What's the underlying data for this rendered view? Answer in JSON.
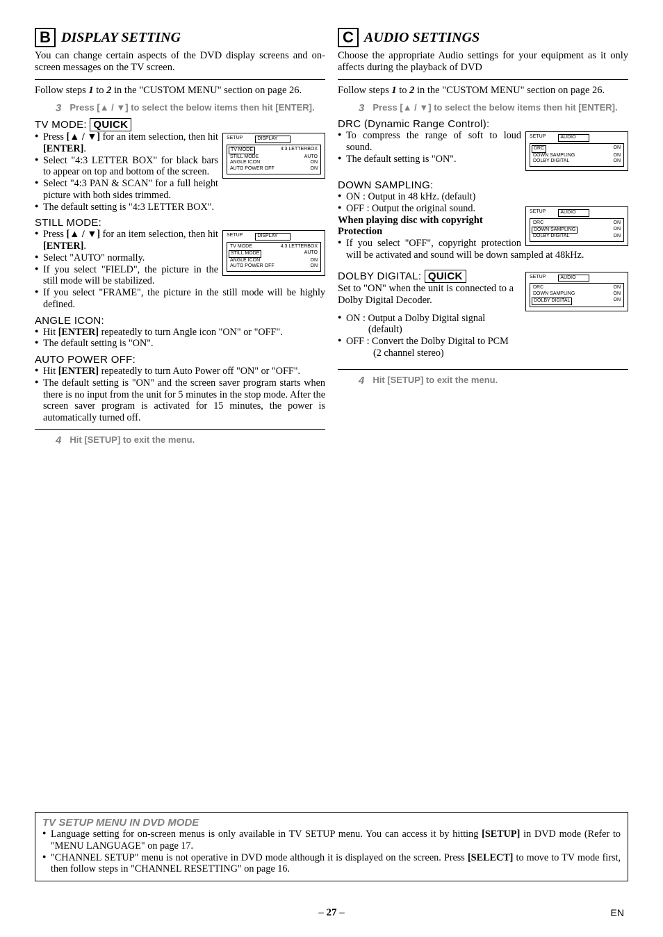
{
  "left": {
    "badge": "B",
    "title": "DISPLAY SETTING",
    "intro": "You can change certain aspects of the DVD display screens and on-screen messages on the TV screen.",
    "followSteps": "Follow steps 1 to 2 in the \"CUSTOM MENU\" section on page 26.",
    "step3num": "3",
    "step3": "Press [▲ / ▼] to select the below items then hit [ENTER].",
    "tvmode": {
      "heading": "TV MODE:",
      "quick": "QUICK",
      "b1a": "Press ",
      "b1b": "[▲ / ▼]",
      "b1c": " for an item selection, then hit ",
      "b1d": "[ENTER]",
      "b1e": ".",
      "b2": "Select \"4:3 LETTER BOX\" for black bars to appear on top and bottom of the screen.",
      "b3": "Select \"4:3 PAN & SCAN\" for a full height picture with both sides trimmed.",
      "b4": "The default setting is \"4:3 LETTER BOX\"."
    },
    "panel1": {
      "setup": "SETUP",
      "tab": "DISPLAY",
      "r1l": "TV MODE",
      "r1r": "4:3 LETTERBOX",
      "r2l": "STILL MODE",
      "r2r": "AUTO",
      "r3l": "ANGLE ICON",
      "r3r": "ON",
      "r4l": "AUTO POWER OFF",
      "r4r": "ON",
      "highlight": 0
    },
    "still": {
      "heading": "STILL MODE:",
      "b1a": "Press ",
      "b1b": "[▲ / ▼]",
      "b1c": " for an item selection, then hit ",
      "b1d": "[ENTER]",
      "b1e": ".",
      "b2": "Select \"AUTO\" normally.",
      "b3": "If you select \"FIELD\", the picture in the still mode will be stabilized.",
      "b4": "If you select \"FRAME\", the picture in the still mode will be highly defined."
    },
    "panel2": {
      "setup": "SETUP",
      "tab": "DISPLAY",
      "r1l": "TV MODE",
      "r1r": "4:3 LETTERBOX",
      "r2l": "STILL MODE",
      "r2r": "AUTO",
      "r3l": "ANGLE ICON",
      "r3r": "ON",
      "r4l": "AUTO POWER OFF",
      "r4r": "ON",
      "highlight": 1
    },
    "angle": {
      "heading": "ANGLE ICON:",
      "b1a": "Hit ",
      "b1b": "[ENTER]",
      "b1c": " repeatedly to turn Angle icon \"ON\" or \"OFF\".",
      "b2": "The default setting is \"ON\"."
    },
    "auto": {
      "heading": "AUTO POWER OFF:",
      "b1a": "Hit ",
      "b1b": "[ENTER]",
      "b1c": " repeatedly to turn Auto Power off \"ON\" or \"OFF\".",
      "b2": "The default setting is \"ON\" and the screen saver program starts when there is no input from the unit for 5 minutes in the stop mode. After the screen saver program is activated for 15 minutes, the power is automatically turned off."
    },
    "step4num": "4",
    "step4": "Hit [SETUP] to exit the menu."
  },
  "right": {
    "badge": "C",
    "title": "AUDIO SETTINGS",
    "intro": "Choose the appropriate Audio settings for your equipment as it only affects during the playback of DVD",
    "followSteps": "Follow steps 1 to 2 in the \"CUSTOM MENU\" section on page 26.",
    "step3num": "3",
    "step3": "Press [▲ / ▼] to select the below items then hit [ENTER].",
    "drc": {
      "heading": "DRC (Dynamic Range Control):",
      "b1": "To compress the range of soft to loud sound.",
      "b2": "The default setting is \"ON\"."
    },
    "panel1": {
      "setup": "SETUP",
      "tab": "AUDIO",
      "r1l": "DRC",
      "r1r": "ON",
      "r2l": "DOWN SAMPLING",
      "r2r": "ON",
      "r3l": "DOLBY DIGITAL",
      "r3r": "ON",
      "highlight": 0
    },
    "down": {
      "heading": "DOWN SAMPLING:",
      "b1": "ON : Output in 48 kHz. (default)",
      "b2": "OFF : Output the original sound.",
      "sub": "When playing disc with copyright Protection",
      "b3": "If you select \"OFF\", copyright protection will be activated and sound will be down sampled at 48kHz."
    },
    "panel2": {
      "setup": "SETUP",
      "tab": "AUDIO",
      "r1l": "DRC",
      "r1r": "ON",
      "r2l": "DOWN SAMPLING",
      "r2r": "ON",
      "r3l": "DOLBY DIGITAL",
      "r3r": "ON",
      "highlight": 1
    },
    "dolby": {
      "heading": "DOLBY DIGITAL:",
      "quick": "QUICK",
      "intro": "Set to \"ON\" when the unit is connected to a Dolby Digital Decoder.",
      "b1": "ON : Output a Dolby Digital signal (default)",
      "b2": "OFF : Convert the Dolby Digital to PCM (2 channel stereo)"
    },
    "panel3": {
      "setup": "SETUP",
      "tab": "AUDIO",
      "r1l": "DRC",
      "r1r": "ON",
      "r2l": "DOWN SAMPLING",
      "r2r": "ON",
      "r3l": "DOLBY DIGITAL",
      "r3r": "ON",
      "highlight": 2
    },
    "step4num": "4",
    "step4": "Hit [SETUP] to exit the menu."
  },
  "footbox": {
    "title": "TV SETUP MENU IN DVD MODE",
    "b1a": "Language setting for on-screen menus is only available in TV SETUP menu. You can access it by hitting ",
    "b1b": "[SETUP]",
    "b1c": " in DVD mode (Refer to \"MENU LANGUAGE\" on page 17.",
    "b2a": "\"CHANNEL SETUP\" menu is not operative in DVD mode although it is displayed on the screen. Press ",
    "b2b": "[SELECT]",
    "b2c": " to move to TV mode first, then follow steps in \"CHANNEL RESETTING\" on page 16."
  },
  "footer": {
    "page": "– 27 –",
    "lang": "EN"
  }
}
